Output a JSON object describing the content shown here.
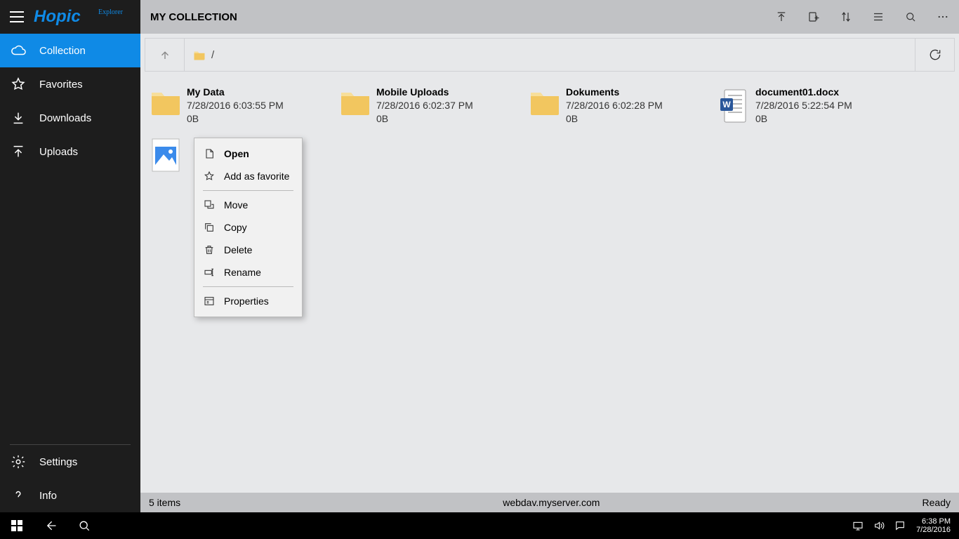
{
  "brand": {
    "name": "Hopic",
    "sup": "Explorer"
  },
  "sidebar": {
    "items": [
      {
        "label": "Collection"
      },
      {
        "label": "Favorites"
      },
      {
        "label": "Downloads"
      },
      {
        "label": "Uploads"
      }
    ],
    "bottom": [
      {
        "label": "Settings"
      },
      {
        "label": "Info"
      }
    ]
  },
  "titlebar": {
    "title": "MY COLLECTION"
  },
  "pathbar": {
    "path": "/"
  },
  "items": [
    {
      "name": "My Data",
      "date": "7/28/2016 6:03:55 PM",
      "size": "0B",
      "kind": "folder"
    },
    {
      "name": "Mobile Uploads",
      "date": "7/28/2016 6:02:37 PM",
      "size": "0B",
      "kind": "folder"
    },
    {
      "name": "Dokuments",
      "date": "7/28/2016 6:02:28 PM",
      "size": "0B",
      "kind": "folder"
    },
    {
      "name": "document01.docx",
      "date": "7/28/2016 5:22:54 PM",
      "size": "0B",
      "kind": "docx"
    },
    {
      "name": "",
      "date": "",
      "size": "",
      "kind": "image"
    }
  ],
  "context_menu": {
    "groups": [
      [
        {
          "label": "Open",
          "bold": true
        },
        {
          "label": "Add as favorite"
        }
      ],
      [
        {
          "label": "Move"
        },
        {
          "label": "Copy"
        },
        {
          "label": "Delete"
        },
        {
          "label": "Rename"
        }
      ],
      [
        {
          "label": "Properties"
        }
      ]
    ]
  },
  "statusbar": {
    "left": "5 items",
    "center": "webdav.myserver.com",
    "right": "Ready"
  },
  "taskbar": {
    "time": "6:38 PM",
    "date": "7/28/2016"
  }
}
